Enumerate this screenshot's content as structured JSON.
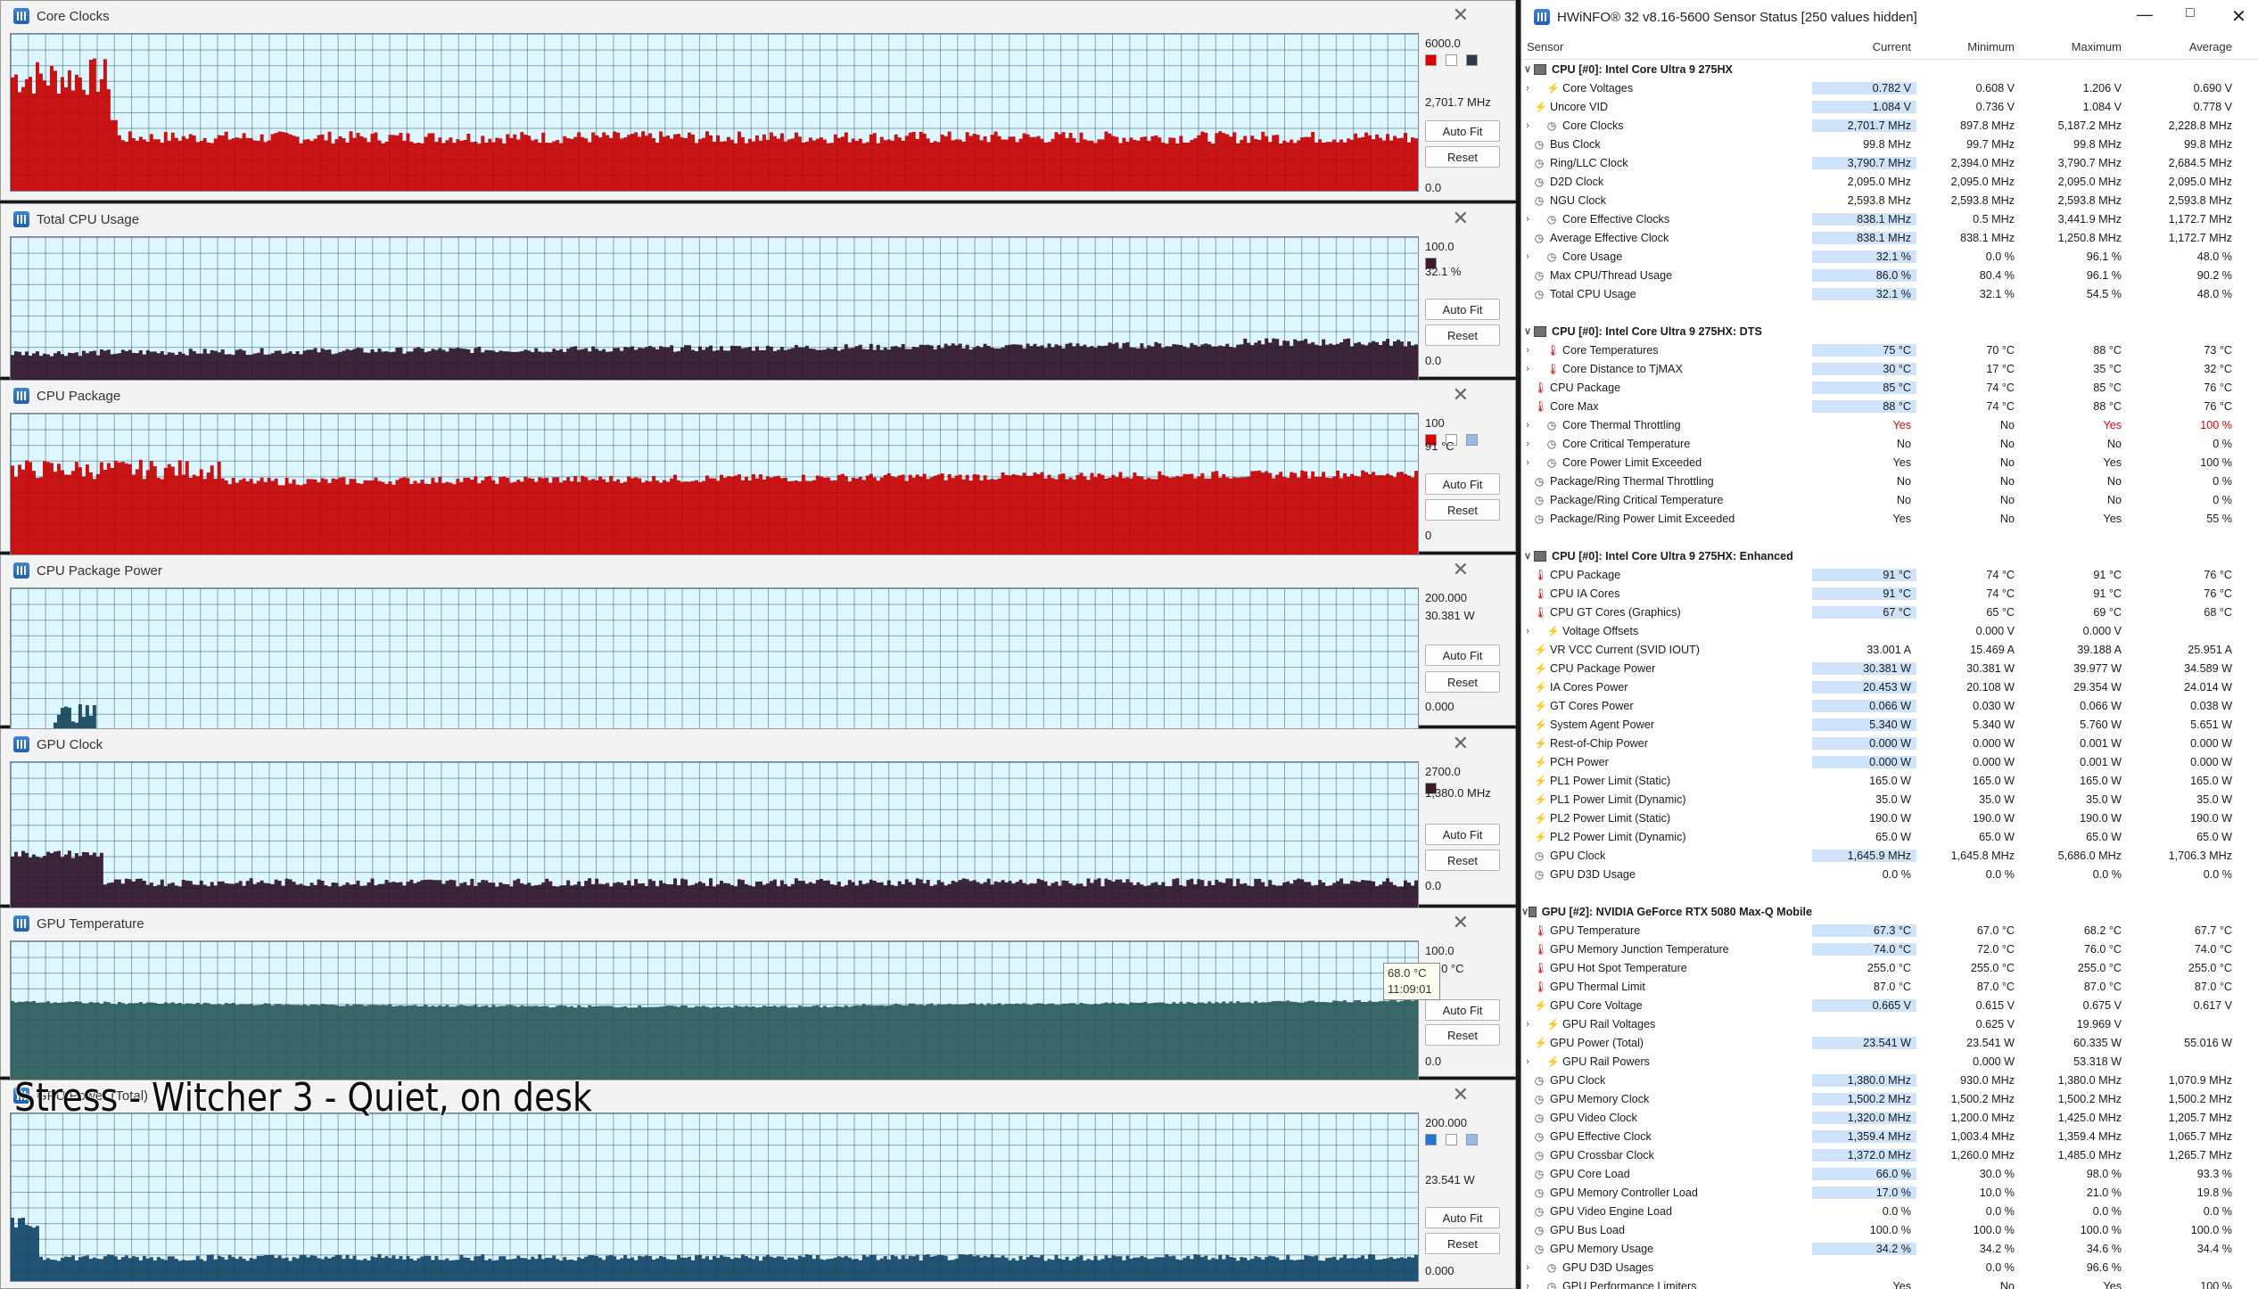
{
  "caption": "Stress - Witcher 3 - Quiet, on desk",
  "tooltip": {
    "value": "68.0 °C",
    "time": "11:09:01"
  },
  "graphs": [
    {
      "title": "Core Clocks",
      "max": "6000.0",
      "current": "2,701.7 MHz",
      "min": "0.0",
      "color": "#c40000",
      "swatches": [
        "#e00000",
        "#ffffff",
        "#2a3a48"
      ],
      "samples": []
    },
    {
      "title": "Total CPU Usage",
      "max": "100.0",
      "current": "32.1 %",
      "min": "0.0",
      "color": "#2c1228",
      "swatches": [
        "#3a1a2a"
      ],
      "samples": []
    },
    {
      "title": "CPU Package",
      "max": "100",
      "current": "91 °C",
      "min": "0",
      "color": "#c40000",
      "swatches": [
        "#e00000",
        "#ffffff",
        "#9ab8e8"
      ],
      "samples": []
    },
    {
      "title": "CPU Package Power",
      "max": "200.000",
      "current": "30.381 W",
      "min": "0.000",
      "color": "#11445a",
      "swatches": [],
      "samples": []
    },
    {
      "title": "GPU Clock",
      "max": "2700.0",
      "current": "1,380.0 MHz",
      "min": "0.0",
      "color": "#2c1228",
      "swatches": [
        "#3a1a2a"
      ],
      "samples": []
    },
    {
      "title": "GPU Temperature",
      "max": "100.0",
      "current": "68.0 °C",
      "min": "0.0",
      "color": "#2a5a5a",
      "swatches": [],
      "samples": []
    },
    {
      "title": "GPU Power (Total)",
      "max": "200.000",
      "current": "23.541 W",
      "min": "0.000",
      "color": "#114466",
      "swatches": [
        "#2277cc",
        "#ffffff",
        "#9ab8e8"
      ],
      "samples": []
    }
  ],
  "buttons": {
    "autofit": "Auto Fit",
    "reset": "Reset"
  },
  "sensor": {
    "title": "HWiNFO® 32 v8.16-5600 Sensor Status [250 values hidden]",
    "columns": [
      "Sensor",
      "Current",
      "Minimum",
      "Maximum",
      "Average"
    ],
    "rows": [
      {
        "t": "g",
        "n": "CPU [#0]: Intel Core Ultra 9 275HX"
      },
      {
        "i": "volt",
        "e": 1,
        "n": "Core Voltages",
        "v": [
          "0.782 V",
          "0.608 V",
          "1.206 V",
          "0.690 V"
        ],
        "h": 1
      },
      {
        "i": "volt",
        "n": "Uncore VID",
        "v": [
          "1.084 V",
          "0.736 V",
          "1.084 V",
          "0.778 V"
        ],
        "h": 1
      },
      {
        "i": "clk",
        "e": 1,
        "n": "Core Clocks",
        "v": [
          "2,701.7 MHz",
          "897.8 MHz",
          "5,187.2 MHz",
          "2,228.8 MHz"
        ],
        "h": 1
      },
      {
        "i": "clk",
        "n": "Bus Clock",
        "v": [
          "99.8 MHz",
          "99.7 MHz",
          "99.8 MHz",
          "99.8 MHz"
        ]
      },
      {
        "i": "clk",
        "n": "Ring/LLC Clock",
        "v": [
          "3,790.7 MHz",
          "2,394.0 MHz",
          "3,790.7 MHz",
          "2,684.5 MHz"
        ],
        "h": 1
      },
      {
        "i": "clk",
        "n": "D2D Clock",
        "v": [
          "2,095.0 MHz",
          "2,095.0 MHz",
          "2,095.0 MHz",
          "2,095.0 MHz"
        ]
      },
      {
        "i": "clk",
        "n": "NGU Clock",
        "v": [
          "2,593.8 MHz",
          "2,593.8 MHz",
          "2,593.8 MHz",
          "2,593.8 MHz"
        ]
      },
      {
        "i": "clk",
        "e": 1,
        "n": "Core Effective Clocks",
        "v": [
          "838.1 MHz",
          "0.5 MHz",
          "3,441.9 MHz",
          "1,172.7 MHz"
        ],
        "h": 1
      },
      {
        "i": "clk",
        "n": "Average Effective Clock",
        "v": [
          "838.1 MHz",
          "838.1 MHz",
          "1,250.8 MHz",
          "1,172.7 MHz"
        ],
        "h": 1
      },
      {
        "i": "clk",
        "e": 1,
        "n": "Core Usage",
        "v": [
          "32.1 %",
          "0.0 %",
          "96.1 %",
          "48.0 %"
        ],
        "h": 1
      },
      {
        "i": "clk",
        "n": "Max CPU/Thread Usage",
        "v": [
          "86.0 %",
          "80.4 %",
          "96.1 %",
          "90.2 %"
        ],
        "h": 1
      },
      {
        "i": "clk",
        "n": "Total CPU Usage",
        "v": [
          "32.1 %",
          "32.1 %",
          "54.5 %",
          "48.0 %"
        ],
        "h": 1
      },
      {
        "t": "s"
      },
      {
        "t": "g",
        "n": "CPU [#0]: Intel Core Ultra 9 275HX: DTS"
      },
      {
        "i": "temp",
        "e": 1,
        "n": "Core Temperatures",
        "v": [
          "75 °C",
          "70 °C",
          "88 °C",
          "73 °C"
        ],
        "h": 1
      },
      {
        "i": "temp",
        "e": 1,
        "n": "Core Distance to TjMAX",
        "v": [
          "30 °C",
          "17 °C",
          "35 °C",
          "32 °C"
        ],
        "h": 1
      },
      {
        "i": "temp",
        "n": "CPU Package",
        "v": [
          "85 °C",
          "74 °C",
          "85 °C",
          "76 °C"
        ],
        "h": 1
      },
      {
        "i": "temp",
        "n": "Core Max",
        "v": [
          "88 °C",
          "74 °C",
          "88 °C",
          "76 °C"
        ],
        "h": 1
      },
      {
        "i": "clk",
        "e": 1,
        "n": "Core Thermal Throttling",
        "v": [
          "Yes",
          "No",
          "Yes",
          "100 %"
        ],
        "r": [
          1,
          0,
          1,
          1
        ]
      },
      {
        "i": "clk",
        "e": 1,
        "n": "Core Critical Temperature",
        "v": [
          "No",
          "No",
          "No",
          "0 %"
        ]
      },
      {
        "i": "clk",
        "e": 1,
        "n": "Core Power Limit Exceeded",
        "v": [
          "Yes",
          "No",
          "Yes",
          "100 %"
        ]
      },
      {
        "i": "clk",
        "n": "Package/Ring Thermal Throttling",
        "v": [
          "No",
          "No",
          "No",
          "0 %"
        ]
      },
      {
        "i": "clk",
        "n": "Package/Ring Critical Temperature",
        "v": [
          "No",
          "No",
          "No",
          "0 %"
        ]
      },
      {
        "i": "clk",
        "n": "Package/Ring Power Limit Exceeded",
        "v": [
          "Yes",
          "No",
          "Yes",
          "55 %"
        ]
      },
      {
        "t": "s"
      },
      {
        "t": "g",
        "n": "CPU [#0]: Intel Core Ultra 9 275HX: Enhanced"
      },
      {
        "i": "temp",
        "n": "CPU Package",
        "v": [
          "91 °C",
          "74 °C",
          "91 °C",
          "76 °C"
        ],
        "h": 1
      },
      {
        "i": "temp",
        "n": "CPU IA Cores",
        "v": [
          "91 °C",
          "74 °C",
          "91 °C",
          "76 °C"
        ],
        "h": 1
      },
      {
        "i": "temp",
        "n": "CPU GT Cores (Graphics)",
        "v": [
          "67 °C",
          "65 °C",
          "69 °C",
          "68 °C"
        ],
        "h": 1
      },
      {
        "i": "volt",
        "e": 1,
        "n": "Voltage Offsets",
        "v": [
          "",
          "0.000 V",
          "0.000 V",
          ""
        ]
      },
      {
        "i": "volt",
        "n": "VR VCC Current (SVID IOUT)",
        "v": [
          "33.001 A",
          "15.469 A",
          "39.188 A",
          "25.951 A"
        ]
      },
      {
        "i": "volt",
        "n": "CPU Package Power",
        "v": [
          "30.381 W",
          "30.381 W",
          "39.977 W",
          "34.589 W"
        ],
        "h": 1
      },
      {
        "i": "volt",
        "n": "IA Cores Power",
        "v": [
          "20.453 W",
          "20.108 W",
          "29.354 W",
          "24.014 W"
        ],
        "h": 1
      },
      {
        "i": "volt",
        "n": "GT Cores Power",
        "v": [
          "0.066 W",
          "0.030 W",
          "0.066 W",
          "0.038 W"
        ],
        "h": 1
      },
      {
        "i": "volt",
        "n": "System Agent Power",
        "v": [
          "5.340 W",
          "5.340 W",
          "5.760 W",
          "5.651 W"
        ],
        "h": 1
      },
      {
        "i": "volt",
        "n": "Rest-of-Chip Power",
        "v": [
          "0.000 W",
          "0.000 W",
          "0.001 W",
          "0.000 W"
        ],
        "h": 1
      },
      {
        "i": "volt",
        "n": "PCH Power",
        "v": [
          "0.000 W",
          "0.000 W",
          "0.001 W",
          "0.000 W"
        ],
        "h": 1
      },
      {
        "i": "volt",
        "n": "PL1 Power Limit (Static)",
        "v": [
          "165.0 W",
          "165.0 W",
          "165.0 W",
          "165.0 W"
        ]
      },
      {
        "i": "volt",
        "n": "PL1 Power Limit (Dynamic)",
        "v": [
          "35.0 W",
          "35.0 W",
          "35.0 W",
          "35.0 W"
        ]
      },
      {
        "i": "volt",
        "n": "PL2 Power Limit (Static)",
        "v": [
          "190.0 W",
          "190.0 W",
          "190.0 W",
          "190.0 W"
        ]
      },
      {
        "i": "volt",
        "n": "PL2 Power Limit (Dynamic)",
        "v": [
          "65.0 W",
          "65.0 W",
          "65.0 W",
          "65.0 W"
        ]
      },
      {
        "i": "clk",
        "n": "GPU Clock",
        "v": [
          "1,645.9 MHz",
          "1,645.8 MHz",
          "5,686.0 MHz",
          "1,706.3 MHz"
        ],
        "h": 1
      },
      {
        "i": "clk",
        "n": "GPU D3D Usage",
        "v": [
          "0.0 %",
          "0.0 %",
          "0.0 %",
          "0.0 %"
        ]
      },
      {
        "t": "s"
      },
      {
        "t": "g",
        "n": "GPU [#2]: NVIDIA  GeForce RTX 5080 Max-Q Mobile"
      },
      {
        "i": "temp",
        "n": "GPU Temperature",
        "v": [
          "67.3 °C",
          "67.0 °C",
          "68.2 °C",
          "67.7 °C"
        ],
        "h": 1
      },
      {
        "i": "temp",
        "n": "GPU Memory Junction Temperature",
        "v": [
          "74.0 °C",
          "72.0 °C",
          "76.0 °C",
          "74.0 °C"
        ],
        "h": 1
      },
      {
        "i": "temp",
        "n": "GPU Hot Spot Temperature",
        "v": [
          "255.0 °C",
          "255.0 °C",
          "255.0 °C",
          "255.0 °C"
        ]
      },
      {
        "i": "temp",
        "n": "GPU Thermal Limit",
        "v": [
          "87.0 °C",
          "87.0 °C",
          "87.0 °C",
          "87.0 °C"
        ]
      },
      {
        "i": "volt",
        "n": "GPU Core Voltage",
        "v": [
          "0.665 V",
          "0.615 V",
          "0.675 V",
          "0.617 V"
        ],
        "h": 1
      },
      {
        "i": "volt",
        "e": 1,
        "n": "GPU Rail Voltages",
        "v": [
          "",
          "0.625 V",
          "19.969 V",
          ""
        ]
      },
      {
        "i": "volt",
        "n": "GPU Power (Total)",
        "v": [
          "23.541 W",
          "23.541 W",
          "60.335 W",
          "55.016 W"
        ],
        "h": 1
      },
      {
        "i": "volt",
        "e": 1,
        "n": "GPU Rail Powers",
        "v": [
          "",
          "0.000 W",
          "53.318 W",
          ""
        ]
      },
      {
        "i": "clk",
        "n": "GPU Clock",
        "v": [
          "1,380.0 MHz",
          "930.0 MHz",
          "1,380.0 MHz",
          "1,070.9 MHz"
        ],
        "h": 1
      },
      {
        "i": "clk",
        "n": "GPU Memory Clock",
        "v": [
          "1,500.2 MHz",
          "1,500.2 MHz",
          "1,500.2 MHz",
          "1,500.2 MHz"
        ],
        "h": 1
      },
      {
        "i": "clk",
        "n": "GPU Video Clock",
        "v": [
          "1,320.0 MHz",
          "1,200.0 MHz",
          "1,425.0 MHz",
          "1,205.7 MHz"
        ],
        "h": 1
      },
      {
        "i": "clk",
        "n": "GPU Effective Clock",
        "v": [
          "1,359.4 MHz",
          "1,003.4 MHz",
          "1,359.4 MHz",
          "1,065.7 MHz"
        ],
        "h": 1
      },
      {
        "i": "clk",
        "n": "GPU Crossbar Clock",
        "v": [
          "1,372.0 MHz",
          "1,260.0 MHz",
          "1,485.0 MHz",
          "1,265.7 MHz"
        ],
        "h": 1
      },
      {
        "i": "clk",
        "n": "GPU Core Load",
        "v": [
          "66.0 %",
          "30.0 %",
          "98.0 %",
          "93.3 %"
        ],
        "h": 1
      },
      {
        "i": "clk",
        "n": "GPU Memory Controller Load",
        "v": [
          "17.0 %",
          "10.0 %",
          "21.0 %",
          "19.8 %"
        ],
        "h": 1
      },
      {
        "i": "clk",
        "n": "GPU Video Engine Load",
        "v": [
          "0.0 %",
          "0.0 %",
          "0.0 %",
          "0.0 %"
        ]
      },
      {
        "i": "clk",
        "n": "GPU Bus Load",
        "v": [
          "100.0 %",
          "100.0 %",
          "100.0 %",
          "100.0 %"
        ]
      },
      {
        "i": "clk",
        "n": "GPU Memory Usage",
        "v": [
          "34.2 %",
          "34.2 %",
          "34.6 %",
          "34.4 %"
        ],
        "h": 1
      },
      {
        "i": "clk",
        "e": 1,
        "n": "GPU D3D Usages",
        "v": [
          "",
          "0.0 %",
          "96.6 %",
          ""
        ]
      },
      {
        "i": "clk",
        "e": 1,
        "n": "GPU Performance Limiters",
        "v": [
          "Yes",
          "No",
          "Yes",
          "100 %"
        ]
      }
    ]
  }
}
